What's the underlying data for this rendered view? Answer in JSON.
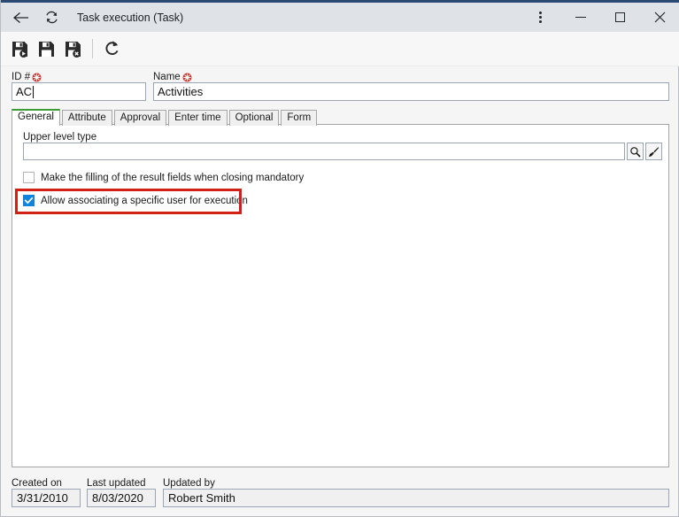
{
  "window": {
    "title": "Task execution (Task)",
    "back_icon": "back-arrow-icon",
    "refresh_icon": "refresh-icon",
    "more_icon": "more-options-icon",
    "minimize_icon": "minimize-icon",
    "maximize_icon": "maximize-icon",
    "close_icon": "close-icon",
    "accent_color": "#2a4a73",
    "titlebar_color": "#dfe3e8"
  },
  "toolbar": {
    "buttons": [
      {
        "name": "save-and-new-button",
        "icon": "save-new-icon"
      },
      {
        "name": "save-button",
        "icon": "save-icon"
      },
      {
        "name": "save-and-close-button",
        "icon": "save-close-icon"
      },
      {
        "name": "refresh-button",
        "icon": "refresh-icon"
      }
    ]
  },
  "header": {
    "id_field": {
      "label": "ID #",
      "value": "AC",
      "required": true
    },
    "name_field": {
      "label": "Name",
      "value": "Activities",
      "required": true
    }
  },
  "tabs": [
    {
      "label": "General",
      "active": true
    },
    {
      "label": "Attribute",
      "active": false
    },
    {
      "label": "Approval",
      "active": false
    },
    {
      "label": "Enter time",
      "active": false
    },
    {
      "label": "Optional",
      "active": false
    },
    {
      "label": "Form",
      "active": false
    }
  ],
  "general_tab": {
    "upper_level_type": {
      "label": "Upper level type",
      "value": "",
      "lookup_icon": "magnifier-icon",
      "clear_icon": "brush-icon"
    },
    "checkboxes": [
      {
        "label": "Make the filling of the result fields when closing mandatory",
        "checked": false
      },
      {
        "label": "Allow associating a specific user for execution",
        "checked": true,
        "highlighted": true
      }
    ]
  },
  "highlight": {
    "color": "#d32017"
  },
  "footer": {
    "created_on": {
      "label": "Created on",
      "value": "3/31/2010"
    },
    "last_updated": {
      "label": "Last updated",
      "value": "8/03/2020"
    },
    "updated_by": {
      "label": "Updated by",
      "value": "Robert Smith"
    }
  }
}
